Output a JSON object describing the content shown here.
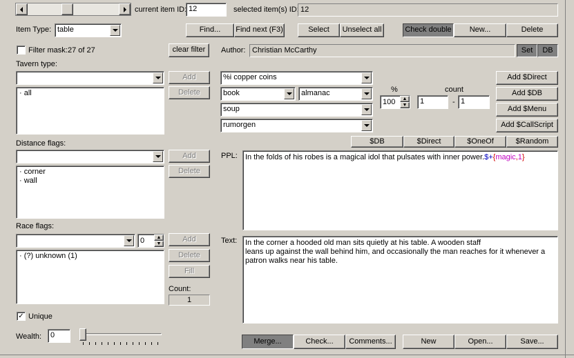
{
  "top": {
    "current_item_label": "current item ID:",
    "current_item_value": "12",
    "selected_label": "selected item(s) ID:",
    "selected_value": "12"
  },
  "item_type": {
    "label": "Item Type:",
    "value": "table"
  },
  "toolbar": {
    "find": "Find...",
    "find_next": "Find next (F3)",
    "select": "Select",
    "unselect_all": "Unselect all",
    "check_double": "Check double",
    "new": "New...",
    "delete": "Delete"
  },
  "filter": {
    "label": "Filter mask:",
    "count": "27 of 27",
    "clear": "clear filter",
    "checked": false
  },
  "author": {
    "label": "Author:",
    "value": "Christian McCarthy",
    "set": "Set",
    "db": "DB"
  },
  "tavern": {
    "label": "Tavern type:",
    "add": "Add",
    "delete": "Delete",
    "items": [
      "all"
    ]
  },
  "distance": {
    "label": "Distance flags:",
    "add": "Add",
    "delete": "Delete",
    "items": [
      "corner",
      "wall"
    ]
  },
  "race": {
    "label": "Race flags:",
    "spin_value": "0",
    "add": "Add",
    "delete": "Delete",
    "fill": "Fill",
    "items": [
      "(?) unknown (1)"
    ],
    "count_label": "Count:",
    "count_value": "1"
  },
  "unique": {
    "label": "Unique",
    "checked": true
  },
  "wealth": {
    "label": "Wealth:",
    "value": "0",
    "slider_level": 0
  },
  "combos": {
    "c1": "%i copper coins",
    "c2a": "book",
    "c2b": "almanac",
    "c3": "soup",
    "c4": "rumorgen"
  },
  "percent": {
    "label": "%",
    "value": "100"
  },
  "count": {
    "label": "count",
    "min": "1",
    "sep": "-",
    "max": "1"
  },
  "add_buttons": [
    "Add $Direct",
    "Add $DB",
    "Add $Menu",
    "Add $CallScript"
  ],
  "insert_buttons": [
    "$DB",
    "$Direct",
    "$OneOf",
    "$Random"
  ],
  "ppl": {
    "label": "PPL:",
    "text": "In the folds of his robes is a magical idol that pulsates with inner power.",
    "t1": "$+",
    "t2": "{",
    "t3": "magic",
    "t4": ",",
    "t5": "1",
    "t6": "}"
  },
  "text": {
    "label": "Text:",
    "line1": "In the corner a hooded old man sits quietly at his table. A wooden staff",
    "line2": "leans up against the wall behind him, and occasionally the man reaches for it whenever a",
    "line3": "patron walks near his table."
  },
  "bottom": {
    "merge": "Merge...",
    "check": "Check...",
    "comments": "Comments...",
    "new": "New",
    "open": "Open...",
    "save": "Save..."
  }
}
